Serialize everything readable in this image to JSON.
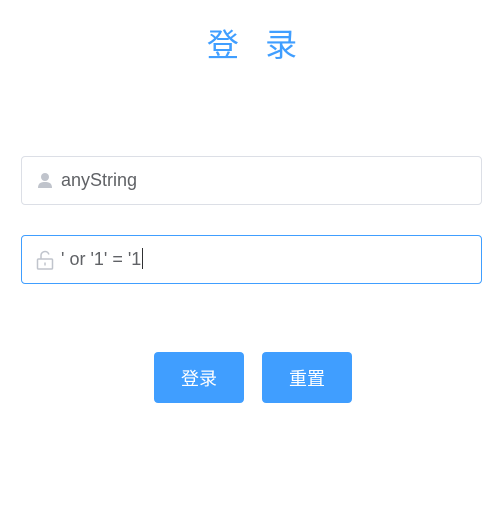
{
  "title": "登 录",
  "username": {
    "icon": "user-icon",
    "value": "anyString"
  },
  "password": {
    "icon": "unlock-icon",
    "value": "' or '1' = '1"
  },
  "buttons": {
    "login_label": "登录",
    "reset_label": "重置"
  },
  "colors": {
    "accent": "#409eff",
    "border": "#dcdfe6",
    "text": "#606266",
    "icon": "#c0c4cc"
  }
}
